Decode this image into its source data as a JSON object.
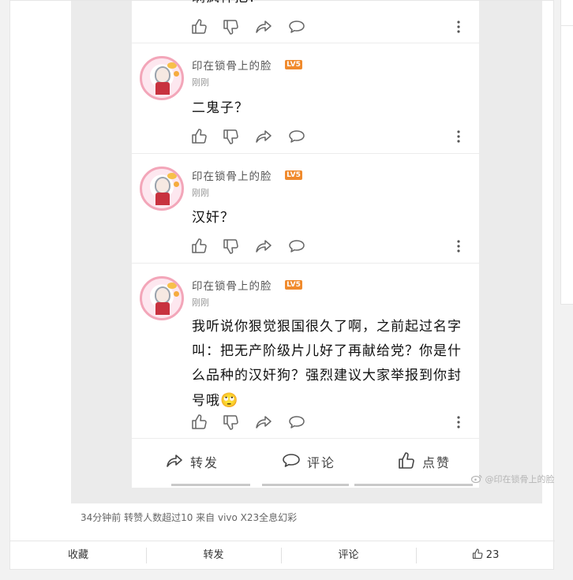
{
  "comments": [
    {
      "username": "",
      "level": "",
      "time": "",
      "text": "瞒疯神把？"
    },
    {
      "username": "印在锁骨上的脸",
      "level": "LV5",
      "time": "刚刚",
      "text": "二鬼子？"
    },
    {
      "username": "印在锁骨上的脸",
      "level": "LV5",
      "time": "刚刚",
      "text": "汉奸？"
    },
    {
      "username": "印在锁骨上的脸",
      "level": "LV5",
      "time": "刚刚",
      "text": "我听说你狠觉狠国很久了啊，之前起过名字叫：把无产阶级片儿好了再献给党？你是什么品种的汉奸狗？强烈建议大家举报到你封号哦",
      "emoji": "🙄"
    }
  ],
  "phone_actions": {
    "repost": "转发",
    "comment": "评论",
    "like": "点赞"
  },
  "watermark": "@印在锁骨上的脸",
  "post_meta": "34分钟前 转赞人数超过10  来自 vivo X23全息幻彩",
  "footer": {
    "favorite": "收藏",
    "repost": "转发",
    "comment": "评论",
    "likes": "23"
  },
  "colors": {
    "level_badge": "#f08a2c",
    "avatar_ring": "#f3a6b9"
  },
  "icons": [
    "thumb-up-icon",
    "thumb-down-icon",
    "share-icon",
    "comment-bubble-icon",
    "more-dots-icon"
  ]
}
